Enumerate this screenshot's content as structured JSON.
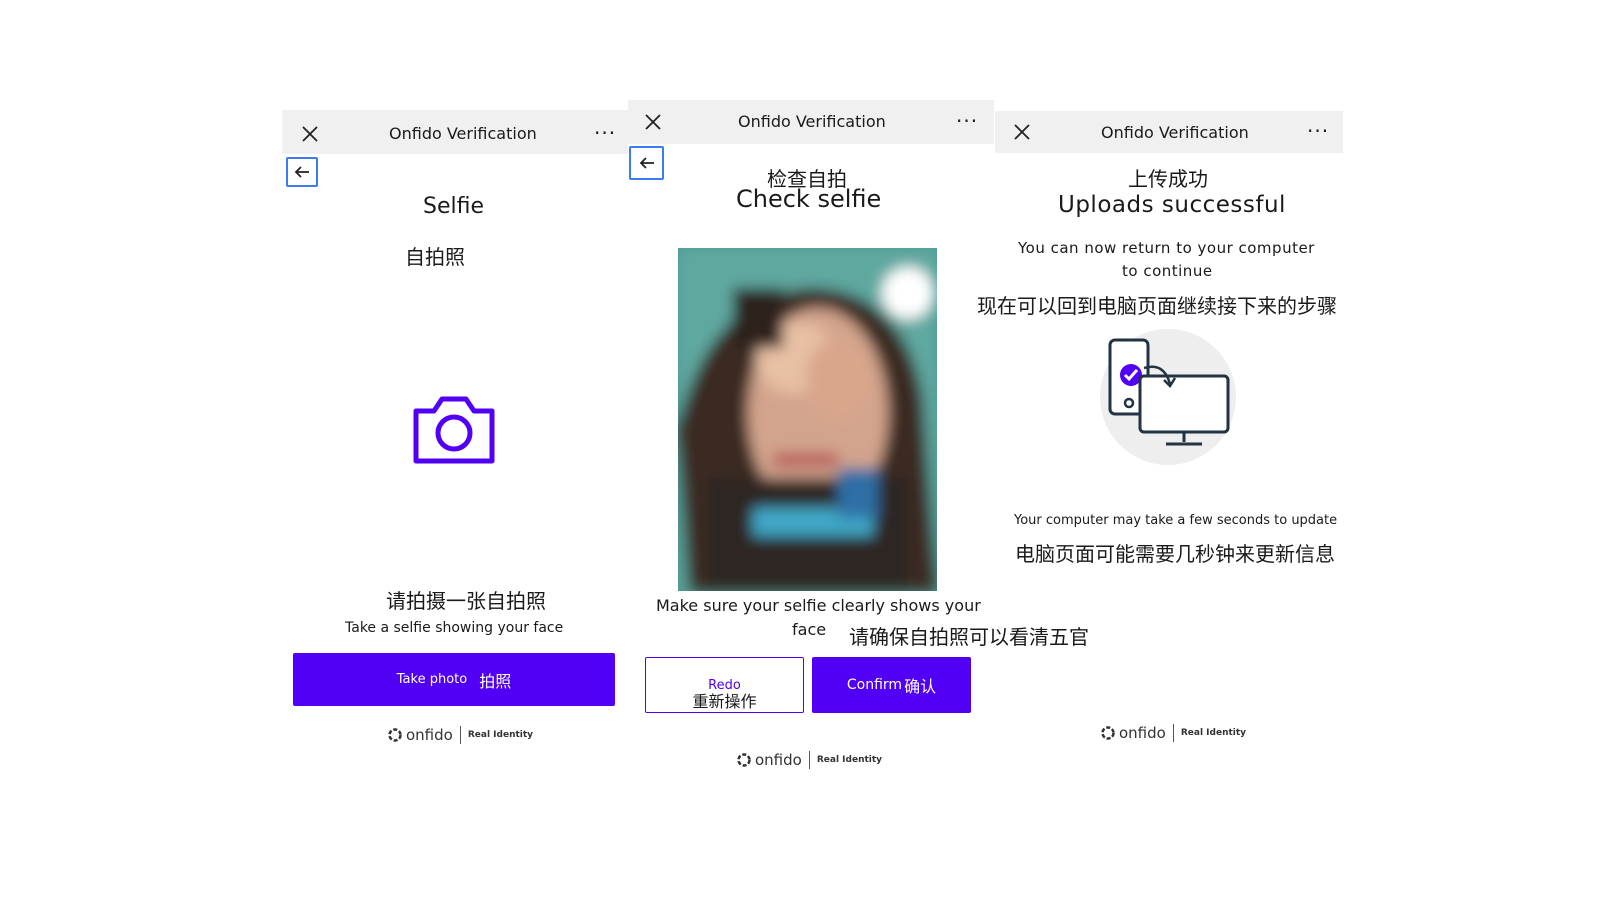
{
  "panel1": {
    "header_title": "Onfido Verification",
    "more": "···",
    "title_en": "Selfie",
    "title_zh": "自拍照",
    "instruction_zh": "请拍摄一张自拍照",
    "instruction_en": "Take a selfie showing your face",
    "button_en": "Take photo",
    "button_zh": "拍照",
    "brand": "onfido",
    "brand_tag": "Real Identity"
  },
  "panel2": {
    "header_title": "Onfido Verification",
    "more": "···",
    "title_zh": "检查自拍",
    "title_en": "Check selfie",
    "hint_en_line1": "Make sure your selfie clearly shows your",
    "hint_en_line2": "face",
    "hint_zh": "请确保自拍照可以看清五官",
    "redo_en": "Redo",
    "redo_zh": "重新操作",
    "confirm_en": "Confirm",
    "confirm_zh": "确认",
    "brand": "onfido",
    "brand_tag": "Real Identity"
  },
  "panel3": {
    "header_title": "Onfido Verification",
    "more": "···",
    "title_zh": "上传成功",
    "title_en": "Uploads successful",
    "msg_en_line1": "You can now return to your computer",
    "msg_en_line2": "to continue",
    "msg_zh": "现在可以回到电脑页面继续接下来的步骤",
    "note_en": "Your computer may take a few seconds to update",
    "note_zh": "电脑页面可能需要几秒钟来更新信息",
    "brand": "onfido",
    "brand_tag": "Real Identity"
  },
  "colors": {
    "accent": "#5200f5",
    "back_border": "#3d7cf0",
    "header_bg": "#f0f0f0",
    "illustration_circle": "#eeeeee",
    "illustration_stroke": "#223344"
  }
}
